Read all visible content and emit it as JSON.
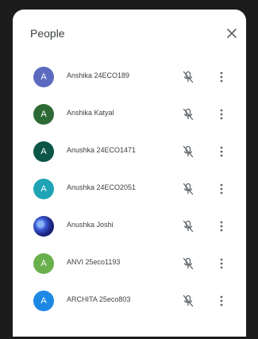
{
  "panel": {
    "title": "People",
    "close_icon": "close-icon"
  },
  "participants": [
    {
      "name": "Anshika 24ECO189",
      "initial": "A",
      "color": "#5c6bc0",
      "photo": false
    },
    {
      "name": "Anshika Katyal",
      "initial": "A",
      "color": "#2e6a35",
      "photo": false
    },
    {
      "name": "Anushka 24ECO1471",
      "initial": "A",
      "color": "#0b5646",
      "photo": false
    },
    {
      "name": "Anushka 24ECO2051",
      "initial": "A",
      "color": "#1fa3b5",
      "photo": false
    },
    {
      "name": "Anushka Joshi",
      "initial": "",
      "color": "#2b3fa8",
      "photo": true
    },
    {
      "name": "ANVI 25eco1193",
      "initial": "A",
      "color": "#6ab04c",
      "photo": false
    },
    {
      "name": "ARCHITA 25eco803",
      "initial": "A",
      "color": "#1e88e5",
      "photo": false
    }
  ],
  "icons": {
    "mic": "mic-off-icon",
    "more": "more-vert-icon"
  }
}
